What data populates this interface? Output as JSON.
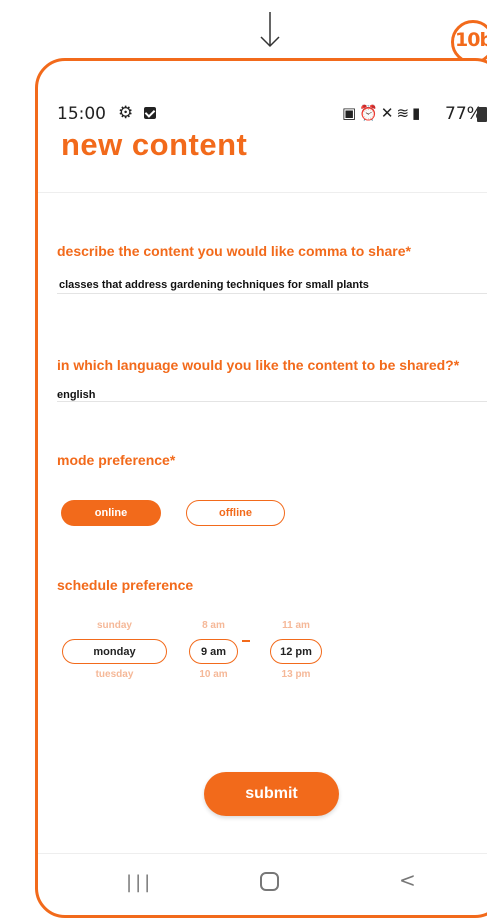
{
  "annotation": {
    "badge": "10b",
    "arrow": "arrow-down-icon"
  },
  "status_bar": {
    "time": "15:00",
    "icons": [
      "gear-icon",
      "checkbox-icon",
      "battery-saver-icon",
      "alarm-icon",
      "mute-icon",
      "wifi-icon",
      "signal-icon"
    ],
    "battery": "77%"
  },
  "page": {
    "title": "new content"
  },
  "form": {
    "content_label": "describe the content you would like comma to share*",
    "content_value": "classes that address gardening techniques for small plants",
    "language_label": "in which language would you like the content to be shared?*",
    "language_value": "english",
    "mode_label": "mode preference*",
    "mode_options": [
      "online",
      "offline"
    ],
    "mode_selected": "online",
    "schedule_label": "schedule preference",
    "day_picker": {
      "above": "sunday",
      "selected": "monday",
      "below": "tuesday"
    },
    "start_picker": {
      "above": "8 am",
      "selected": "9 am",
      "below": "10 am"
    },
    "end_picker": {
      "above": "11 am",
      "selected": "12 pm",
      "below": "13 pm"
    },
    "submit_label": "submit"
  },
  "nav_bar": {
    "recent": "|||",
    "home": "home-icon",
    "back": "<"
  },
  "colors": {
    "accent": "#f26a1b",
    "faded": "#f5b898"
  }
}
